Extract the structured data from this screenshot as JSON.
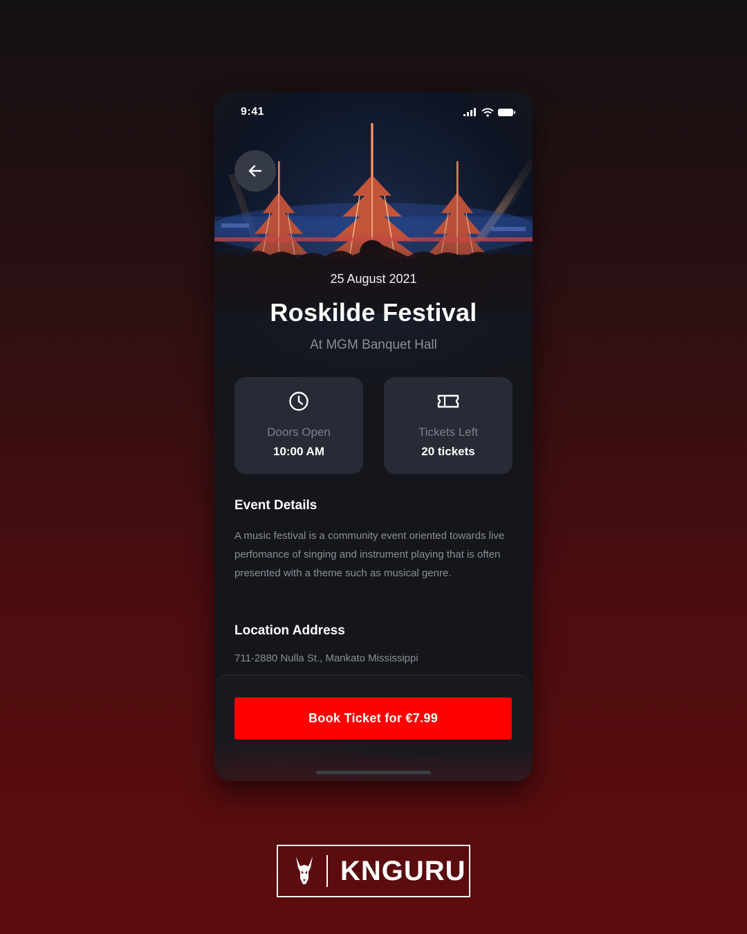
{
  "status_bar": {
    "time": "9:41"
  },
  "event": {
    "date": "25 August 2021",
    "title": "Roskilde Festival",
    "venue": "At MGM Banquet Hall"
  },
  "info_cards": {
    "doors": {
      "icon": "clock-icon",
      "label": "Doors Open",
      "value": "10:00 AM"
    },
    "tickets": {
      "icon": "ticket-icon",
      "label": "Tickets Left",
      "value": "20 tickets"
    }
  },
  "details": {
    "title": "Event Details",
    "text": "A music festival is a community event oriented towards live perfomance of singing and instrument playing that is often presented with a theme such as musical genre."
  },
  "location": {
    "title": "Location Address",
    "address": "711-2880 Nulla St., Mankato Mississippi"
  },
  "cta": {
    "label": "Book Ticket for €7.99",
    "color": "#fe0000"
  },
  "brand": {
    "name": "KNGURU"
  }
}
